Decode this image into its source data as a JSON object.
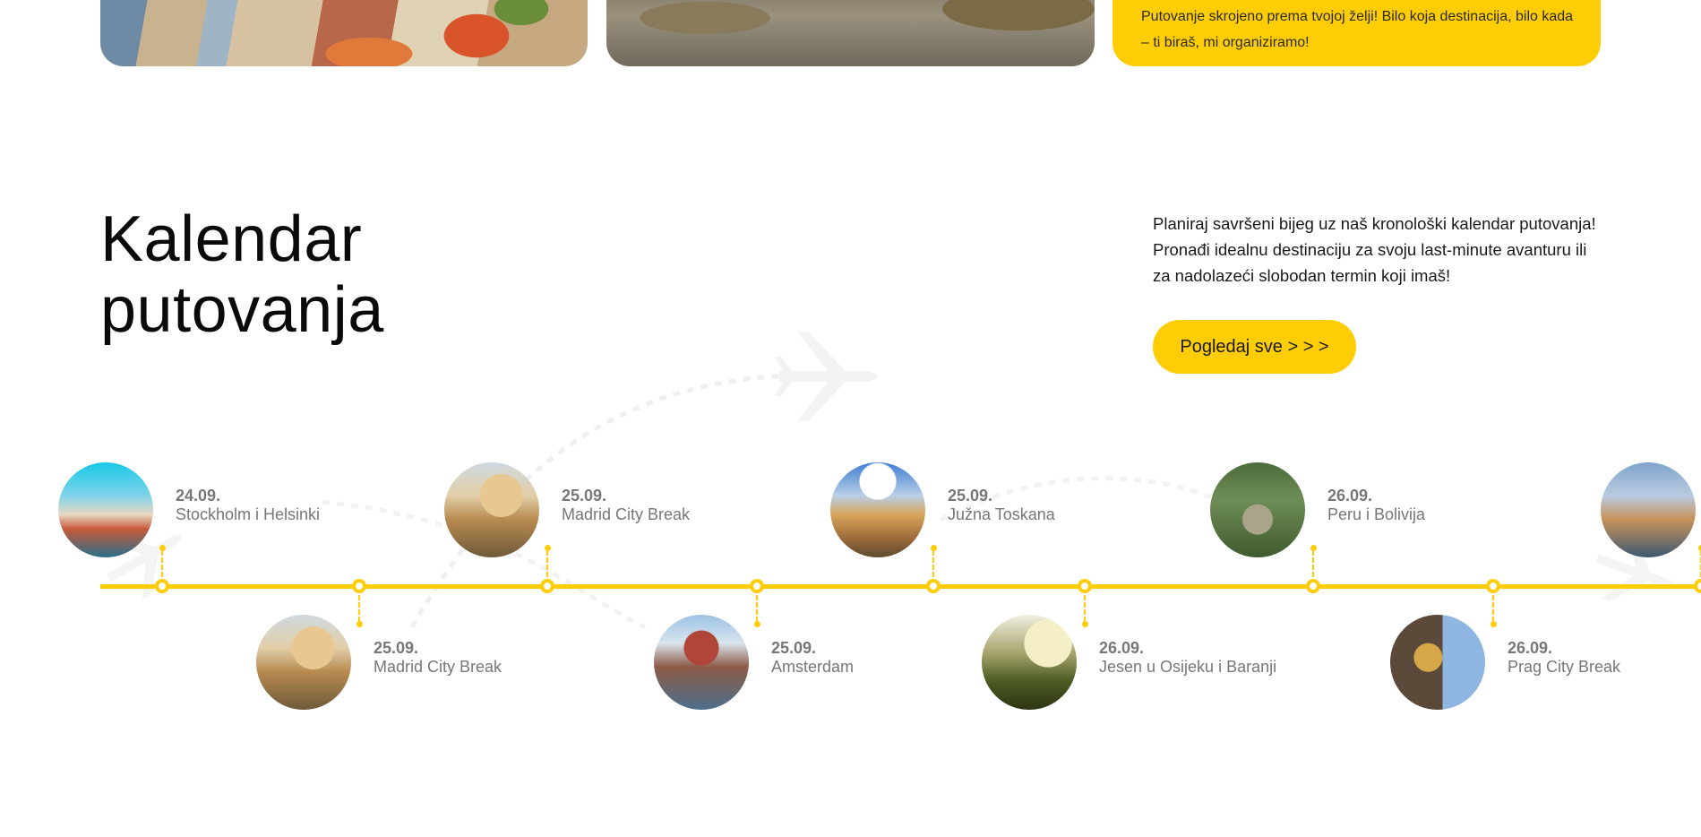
{
  "top_cards": {
    "promo_text": "Putovanje skrojeno prema tvojoj želji! Bilo koja destinacija, bilo kada – ti biraš, mi organiziramo!"
  },
  "section": {
    "title_line1": "Kalendar",
    "title_line2": "putovanja",
    "intro_line1": "Planiraj savršeni bijeg uz naš kronološki kalendar putovanja!",
    "intro_line2": "Pronađi idealnu destinaciju za svoju last-minute avanturu ili",
    "intro_line3": "za nadolazeći slobodan termin koji imaš!",
    "cta_label": "Pogledaj sve > > >"
  },
  "colors": {
    "accent": "#ffcd05",
    "timeline": "#ffcc08",
    "muted_text": "#777777"
  },
  "timeline": {
    "trips": [
      {
        "date": "24.09.",
        "name": "Stockholm i Helsinki",
        "image": "stockholm-photo"
      },
      {
        "date": "25.09.",
        "name": "Madrid City Break",
        "image": "toledo-photo"
      },
      {
        "date": "25.09.",
        "name": "Madrid City Break",
        "image": "toledo-photo"
      },
      {
        "date": "25.09.",
        "name": "Amsterdam",
        "image": "amsterdam-photo"
      },
      {
        "date": "25.09.",
        "name": "Južna Toskana",
        "image": "tuscany-photo"
      },
      {
        "date": "26.09.",
        "name": "Jesen u Osijeku i Baranji",
        "image": "vineyard-photo"
      },
      {
        "date": "26.09.",
        "name": "Peru i Bolivija",
        "image": "machu-picchu-photo"
      },
      {
        "date": "26.09.",
        "name": "Prag City Break",
        "image": "prague-clock-photo"
      },
      {
        "date": "",
        "name": "",
        "image": "bridge-city-photo"
      }
    ]
  }
}
